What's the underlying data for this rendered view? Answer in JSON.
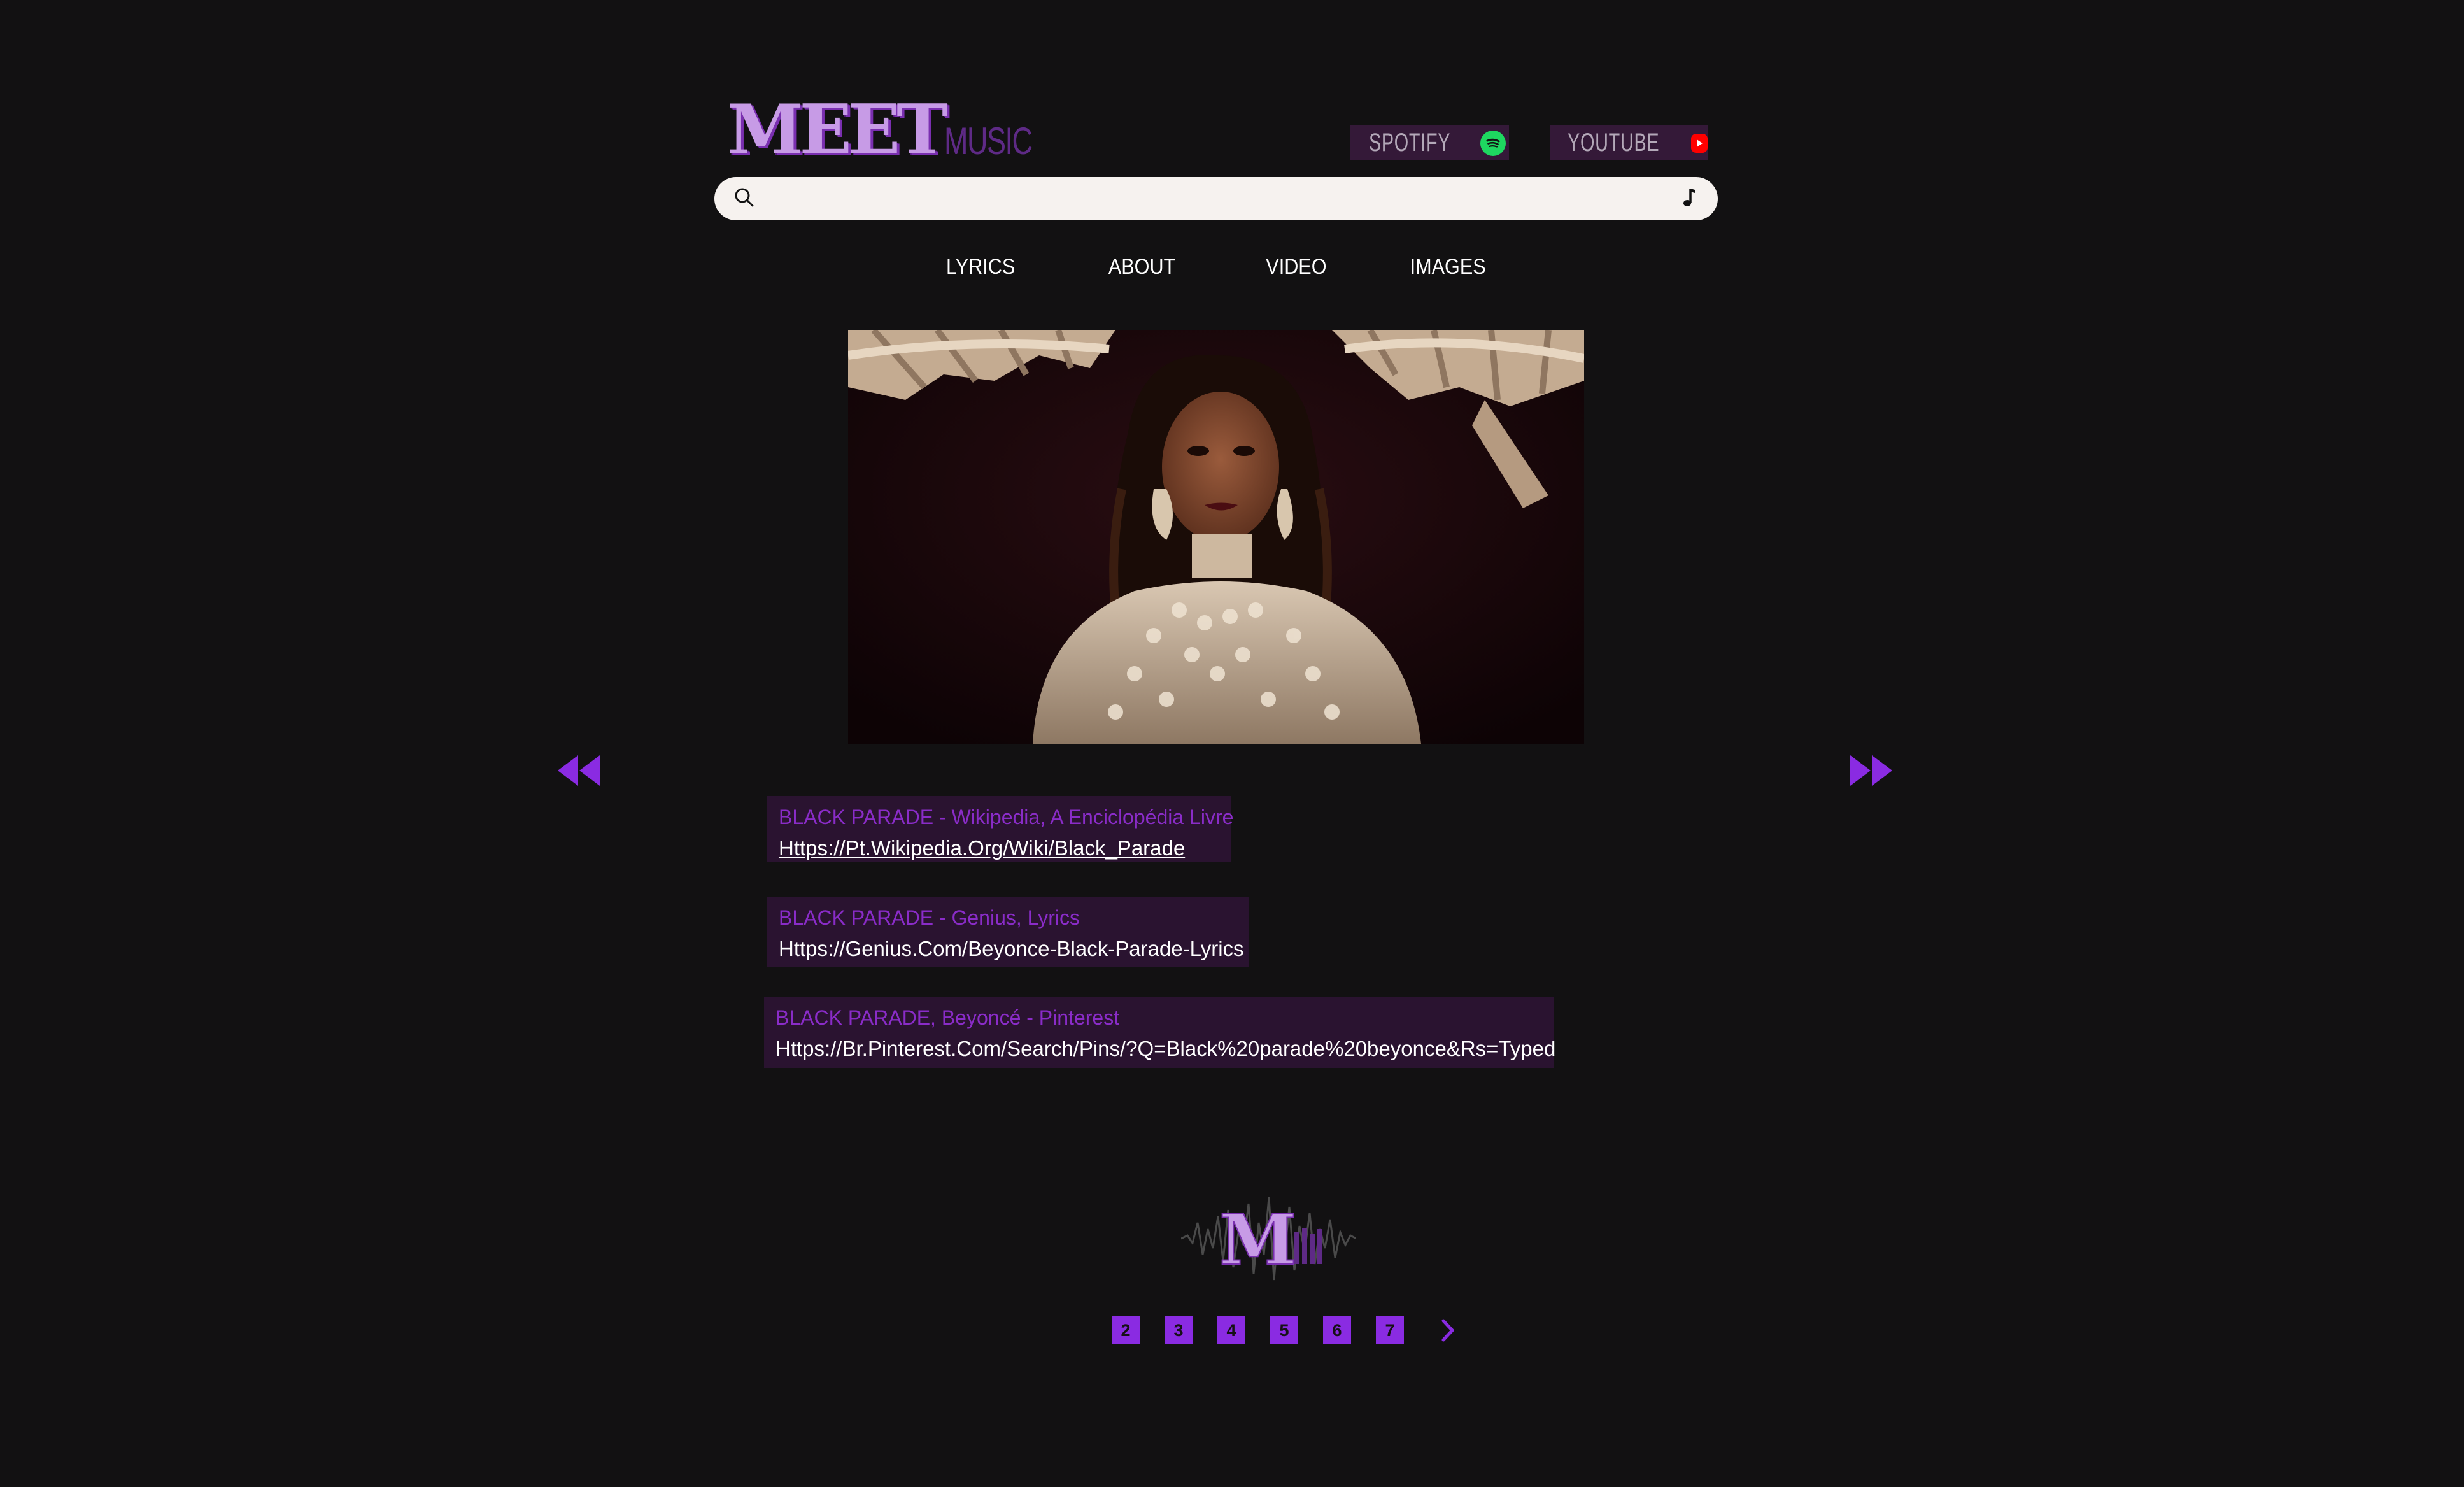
{
  "header": {
    "logo_main": "MEET",
    "logo_sub": "MUSIC",
    "spotify_label": "SPOTIFY",
    "youtube_label": "YOUTUBE"
  },
  "search": {
    "value": "",
    "placeholder": ""
  },
  "nav": {
    "items": [
      {
        "label": "LYRICS"
      },
      {
        "label": "ABOUT"
      },
      {
        "label": "VIDEO"
      },
      {
        "label": "IMAGES"
      }
    ]
  },
  "results": [
    {
      "title": "BLACK PARADE - Wikipedia, A Enciclopédia Livre",
      "url": "Https://Pt.Wikipedia.Org/Wiki/Black_Parade"
    },
    {
      "title": "BLACK PARADE - Genius, Lyrics",
      "url": "Https://Genius.Com/Beyonce-Black-Parade-Lyrics"
    },
    {
      "title": "BLACK PARADE, Beyoncé - Pinterest",
      "url": "Https://Br.Pinterest.Com/Search/Pins/?Q=Black%20parade%20beyonce&Rs=Typed"
    }
  ],
  "footer": {
    "logo_letter": "M"
  },
  "pagination": {
    "pages": [
      "2",
      "3",
      "4",
      "5",
      "6",
      "7"
    ]
  },
  "colors": {
    "background": "#121112",
    "accent": "#8a2be2",
    "result_bg": "#2a1330",
    "logo_light": "#c79be6"
  },
  "icons": {
    "search": "search-icon",
    "music": "music-note-icon",
    "prev": "rewind-icon",
    "next": "fast-forward-icon"
  }
}
